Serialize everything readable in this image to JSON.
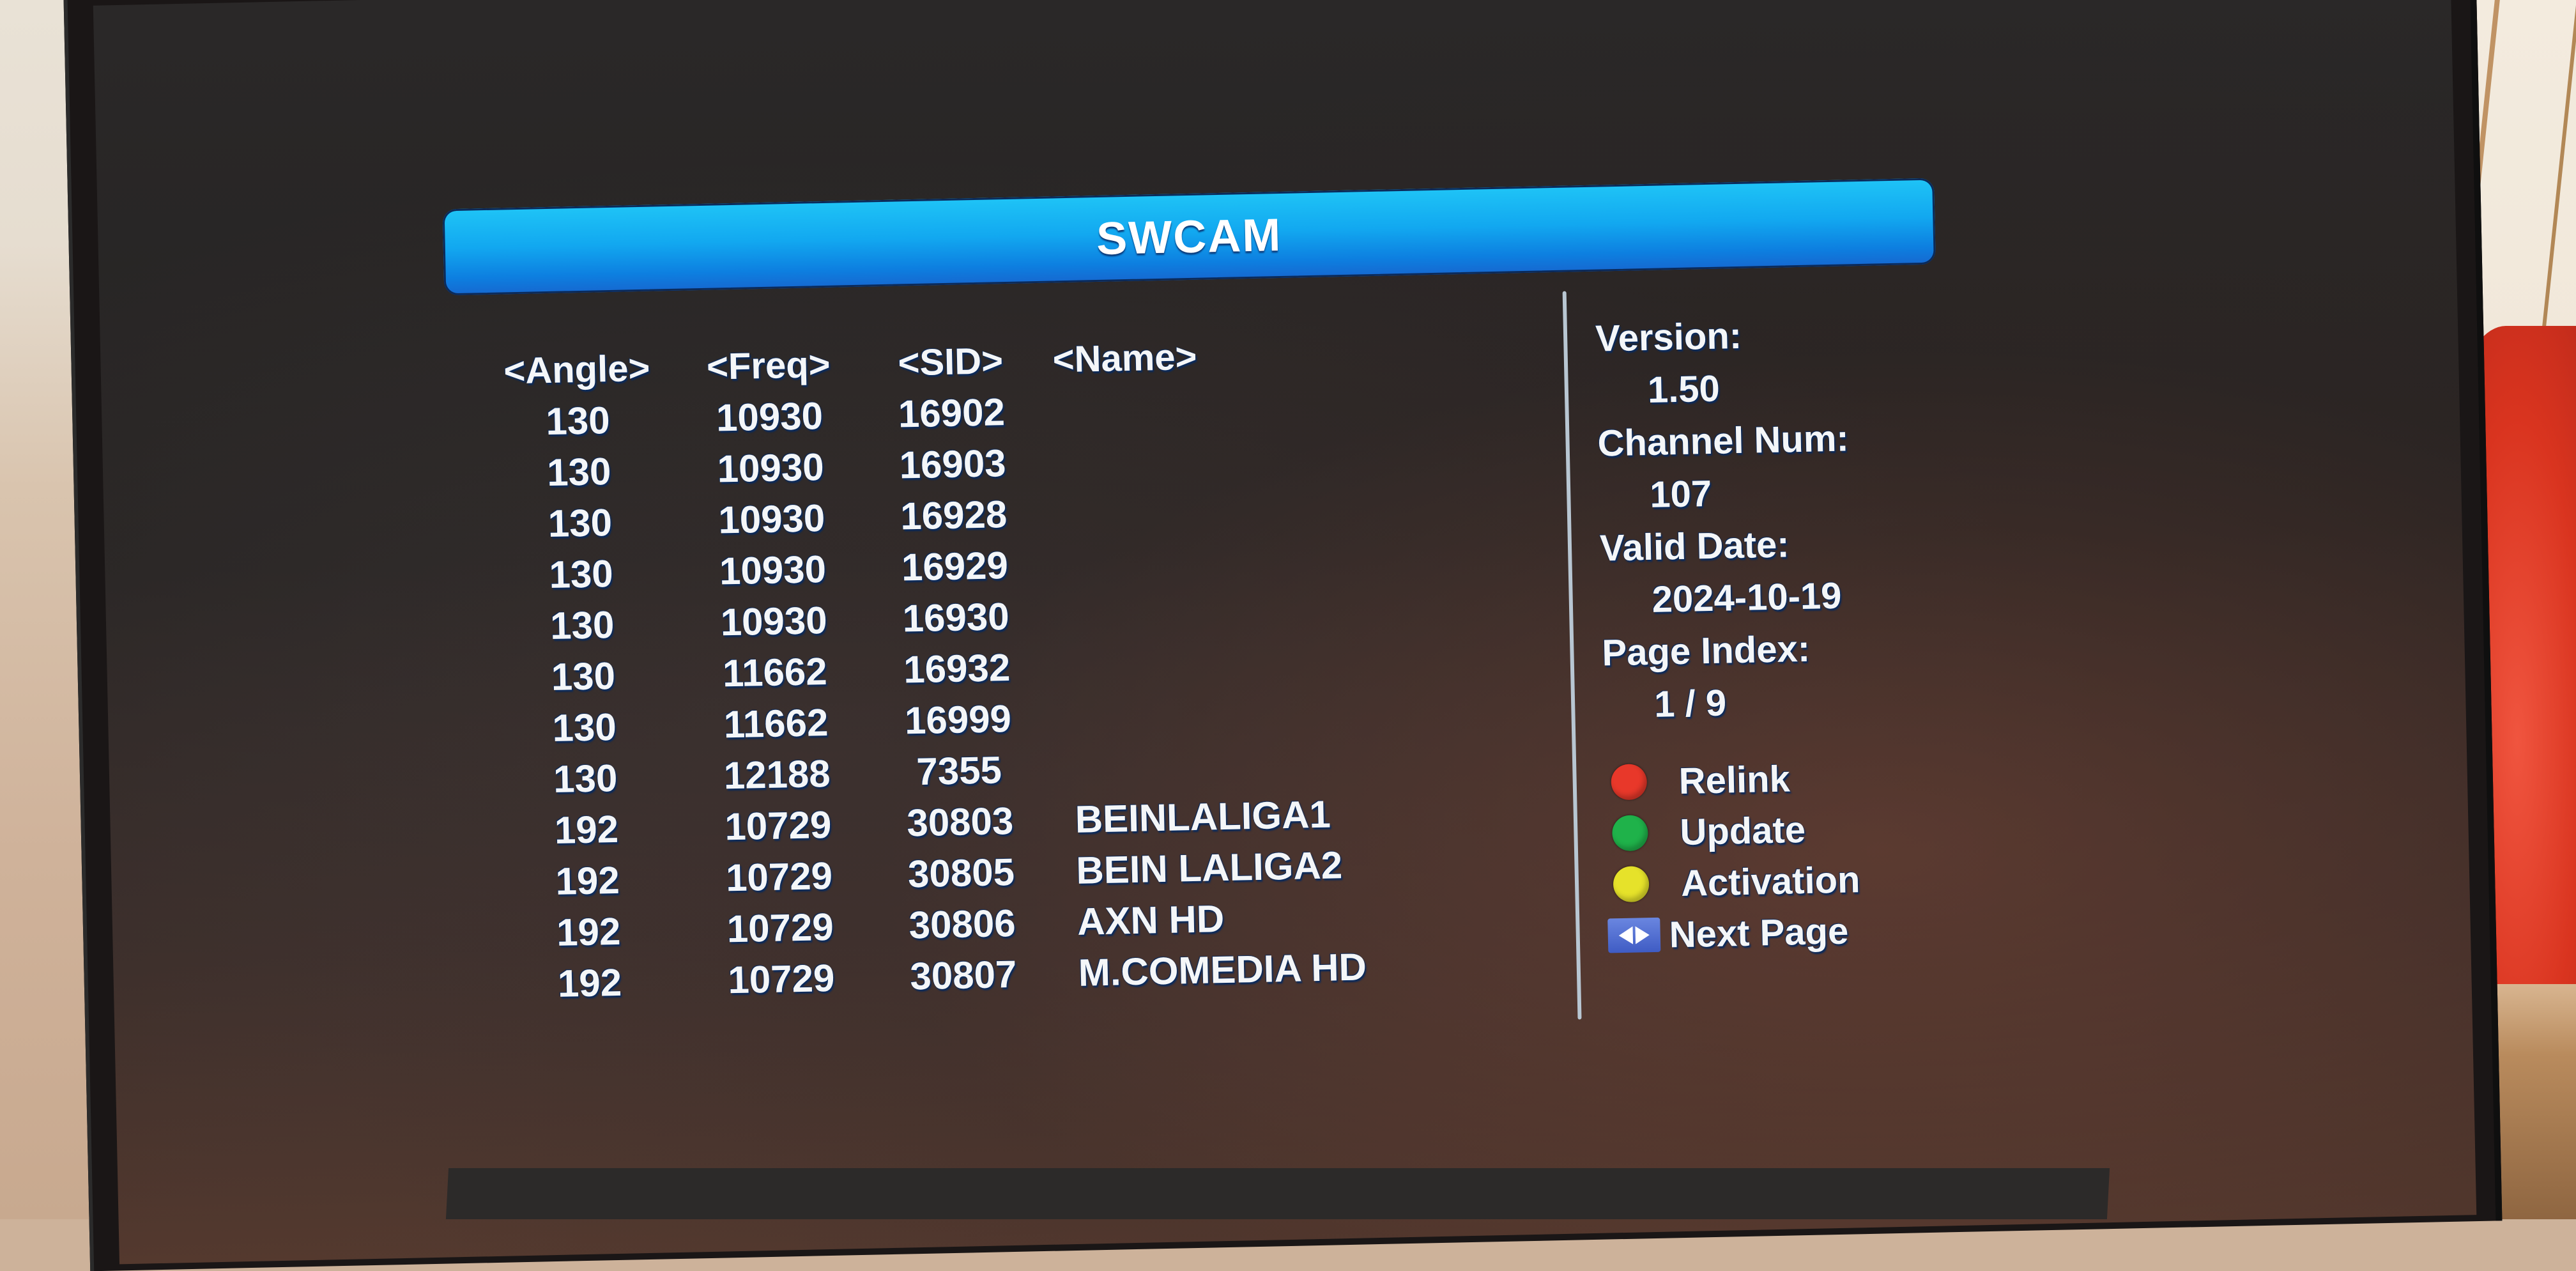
{
  "osd": {
    "title": "SWCAM",
    "table": {
      "headers": {
        "angle": "<Angle>",
        "freq": "<Freq>",
        "sid": "<SID>",
        "name": "<Name>"
      },
      "rows": [
        {
          "angle": "130",
          "freq": "10930",
          "sid": "16902",
          "name": ""
        },
        {
          "angle": "130",
          "freq": "10930",
          "sid": "16903",
          "name": ""
        },
        {
          "angle": "130",
          "freq": "10930",
          "sid": "16928",
          "name": ""
        },
        {
          "angle": "130",
          "freq": "10930",
          "sid": "16929",
          "name": ""
        },
        {
          "angle": "130",
          "freq": "10930",
          "sid": "16930",
          "name": ""
        },
        {
          "angle": "130",
          "freq": "11662",
          "sid": "16932",
          "name": ""
        },
        {
          "angle": "130",
          "freq": "11662",
          "sid": "16999",
          "name": ""
        },
        {
          "angle": "130",
          "freq": "12188",
          "sid": "7355",
          "name": ""
        },
        {
          "angle": "192",
          "freq": "10729",
          "sid": "30803",
          "name": "BEINLALIGA1"
        },
        {
          "angle": "192",
          "freq": "10729",
          "sid": "30805",
          "name": "BEIN LALIGA2"
        },
        {
          "angle": "192",
          "freq": "10729",
          "sid": "30806",
          "name": "AXN HD"
        },
        {
          "angle": "192",
          "freq": "10729",
          "sid": "30807",
          "name": "M.COMEDIA HD"
        }
      ]
    },
    "info": {
      "version_label": "Version:",
      "version_value": "1.50",
      "channel_num_label": "Channel Num:",
      "channel_num_value": "107",
      "valid_date_label": "Valid Date:",
      "valid_date_value": "2024-10-19",
      "page_index_label": "Page Index:",
      "page_index_value": "1 / 9"
    },
    "legend": [
      {
        "key": "red-button",
        "label": "Relink",
        "color": "#e8382a"
      },
      {
        "key": "green-button",
        "label": "Update",
        "color": "#1fb24a"
      },
      {
        "key": "yellow-button",
        "label": "Activation",
        "color": "#e6e22a"
      },
      {
        "key": "left-right-arrows",
        "label": "Next Page",
        "color": "#4f6fd0"
      }
    ]
  }
}
